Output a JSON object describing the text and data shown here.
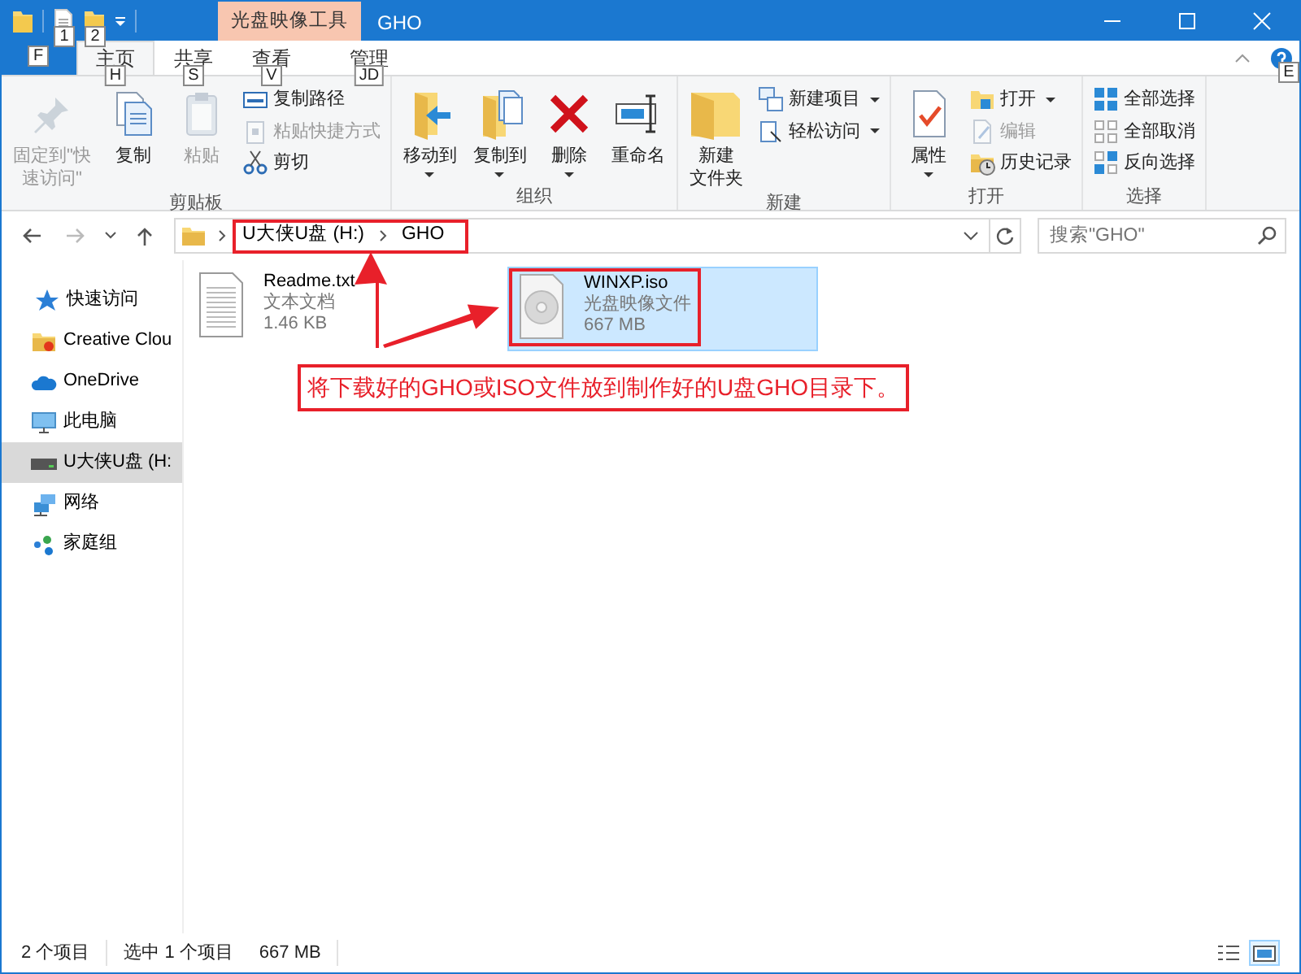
{
  "title_bar": {
    "quick_access_keytips": [
      "1",
      "2"
    ],
    "context_tab": "光盘映像工具",
    "title": "GHO"
  },
  "file_tab": {
    "keytip": "F"
  },
  "ribbon_tabs": [
    {
      "label": "主页",
      "selected": true,
      "keytip": "H"
    },
    {
      "label": "共享",
      "selected": false,
      "keytip": "S"
    },
    {
      "label": "查看",
      "selected": false,
      "keytip": "V"
    },
    {
      "label": "管理",
      "selected": false,
      "keytip": "JD"
    }
  ],
  "help": {
    "keytip": "E"
  },
  "ribbon_groups": [
    {
      "label": "剪贴板",
      "commands": [
        {
          "kind": "large",
          "lines": [
            "固定到\"快",
            "速访问\""
          ],
          "disabled": true,
          "dropdown": false
        },
        {
          "kind": "large",
          "lines": [
            "复制"
          ],
          "disabled": false,
          "dropdown": false
        },
        {
          "kind": "large",
          "lines": [
            "粘贴"
          ],
          "disabled": true,
          "dropdown": false
        },
        {
          "kind": "stack",
          "items": [
            {
              "label": "复制路径",
              "disabled": false,
              "dropdown": false
            },
            {
              "label": "粘贴快捷方式",
              "disabled": true,
              "dropdown": false
            },
            {
              "label": "剪切",
              "disabled": false,
              "dropdown": false
            }
          ]
        }
      ]
    },
    {
      "label": "组织",
      "commands": [
        {
          "kind": "large",
          "lines": [
            "移动到"
          ],
          "disabled": false,
          "dropdown": true
        },
        {
          "kind": "large",
          "lines": [
            "复制到"
          ],
          "disabled": false,
          "dropdown": true
        },
        {
          "kind": "large",
          "lines": [
            "删除"
          ],
          "disabled": false,
          "dropdown": true
        },
        {
          "kind": "large",
          "lines": [
            "重命名"
          ],
          "disabled": false,
          "dropdown": false
        }
      ]
    },
    {
      "label": "新建",
      "commands": [
        {
          "kind": "large",
          "lines": [
            "新建",
            "文件夹"
          ],
          "disabled": false,
          "dropdown": false
        },
        {
          "kind": "stack",
          "items": [
            {
              "label": "新建项目",
              "disabled": false,
              "dropdown": true
            },
            {
              "label": "轻松访问",
              "disabled": false,
              "dropdown": true
            }
          ]
        }
      ]
    },
    {
      "label": "打开",
      "commands": [
        {
          "kind": "large",
          "lines": [
            "属性"
          ],
          "disabled": false,
          "dropdown": true
        },
        {
          "kind": "stack",
          "items": [
            {
              "label": "打开",
              "disabled": false,
              "dropdown": true
            },
            {
              "label": "编辑",
              "disabled": true,
              "dropdown": false
            },
            {
              "label": "历史记录",
              "disabled": false,
              "dropdown": false
            }
          ]
        }
      ]
    },
    {
      "label": "选择",
      "commands": [
        {
          "kind": "stack",
          "items": [
            {
              "label": "全部选择",
              "disabled": false,
              "dropdown": false
            },
            {
              "label": "全部取消",
              "disabled": false,
              "dropdown": false
            },
            {
              "label": "反向选择",
              "disabled": false,
              "dropdown": false
            }
          ]
        }
      ]
    }
  ],
  "address_bar": {
    "breadcrumbs": [
      "U大侠U盘 (H:)",
      "GHO"
    ],
    "highlighted": true,
    "search_placeholder": "搜索\"GHO\""
  },
  "navigation_pane": [
    {
      "label": "快速访问",
      "selected": false
    },
    {
      "label": "Creative Clou",
      "selected": false
    },
    {
      "label": "OneDrive",
      "selected": false
    },
    {
      "label": "此电脑",
      "selected": false
    },
    {
      "label": "U大侠U盘 (H:",
      "selected": true
    },
    {
      "label": "网络",
      "selected": false
    },
    {
      "label": "家庭组",
      "selected": false
    }
  ],
  "files": [
    {
      "name": "Readme.txt",
      "type": "文本文档",
      "size": "1.46 KB",
      "selected": false,
      "highlighted": false
    },
    {
      "name": "WINXP.iso",
      "type": "光盘映像文件",
      "size": "667 MB",
      "selected": true,
      "highlighted": true
    }
  ],
  "annotation": {
    "text": "将下载好的GHO或ISO文件放到制作好的U盘GHO目录下。"
  },
  "status_bar": {
    "item_count": "2 个项目",
    "selection": "选中 1 个项目",
    "selection_size": "667 MB",
    "view_buttons": [
      {
        "selected": false
      },
      {
        "selected": true
      }
    ]
  }
}
